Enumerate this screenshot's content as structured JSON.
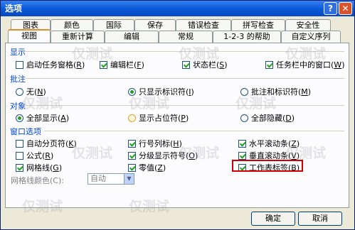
{
  "window": {
    "title": "选项",
    "help_glyph": "?",
    "close_glyph": "✕"
  },
  "tabs_back": [
    "图表",
    "颜色",
    "国际",
    "保存",
    "错误检查",
    "拼写检查",
    "安全性"
  ],
  "tabs_front": [
    "视图",
    "重新计算",
    "编辑",
    "常规",
    "1-2-3 的帮助",
    "自定义序列"
  ],
  "active_tab": "视图",
  "sections": {
    "show": {
      "title": "显示",
      "items": [
        {
          "label": "启动任务窗格",
          "key": "R",
          "checked": false
        },
        {
          "label": "编辑栏",
          "key": "F",
          "checked": true
        },
        {
          "label": "状态栏",
          "key": "S",
          "checked": true
        },
        {
          "label": "任务栏中的窗口",
          "key": "W",
          "checked": true
        }
      ]
    },
    "comments": {
      "title": "批注",
      "items": [
        {
          "label": "无",
          "key": "N",
          "selected": false
        },
        {
          "label": "只显示标识符",
          "key": "I",
          "selected": true
        },
        {
          "label": "批注和标识符",
          "key": "M",
          "selected": false
        }
      ]
    },
    "objects": {
      "title": "对象",
      "items": [
        {
          "label": "全部显示",
          "key": "A",
          "selected": true
        },
        {
          "label": "显示占位符",
          "key": "P",
          "selected": false
        },
        {
          "label": "全部隐藏",
          "key": "D",
          "selected": false
        }
      ]
    },
    "window_options": {
      "title": "窗口选项",
      "items": [
        {
          "label": "自动分页符",
          "key": "K",
          "checked": false
        },
        {
          "label": "行号列标",
          "key": "H",
          "checked": true
        },
        {
          "label": "水平滚动条",
          "key": "Z",
          "checked": true
        },
        {
          "label": "公式",
          "key": "R",
          "checked": false
        },
        {
          "label": "分级显示符号",
          "key": "O",
          "checked": true
        },
        {
          "label": "垂直滚动条",
          "key": "V",
          "checked": true
        },
        {
          "label": "网格线",
          "key": "G",
          "checked": true
        },
        {
          "label": "零值",
          "key": "Z",
          "checked": true
        },
        {
          "label": "工作表标签",
          "key": "B",
          "checked": true
        }
      ],
      "grid_color_label": "网格线颜色(C):",
      "grid_color_value": "自动"
    }
  },
  "buttons": {
    "ok": "确定",
    "cancel": "取消"
  },
  "watermark_text": "仅测试"
}
